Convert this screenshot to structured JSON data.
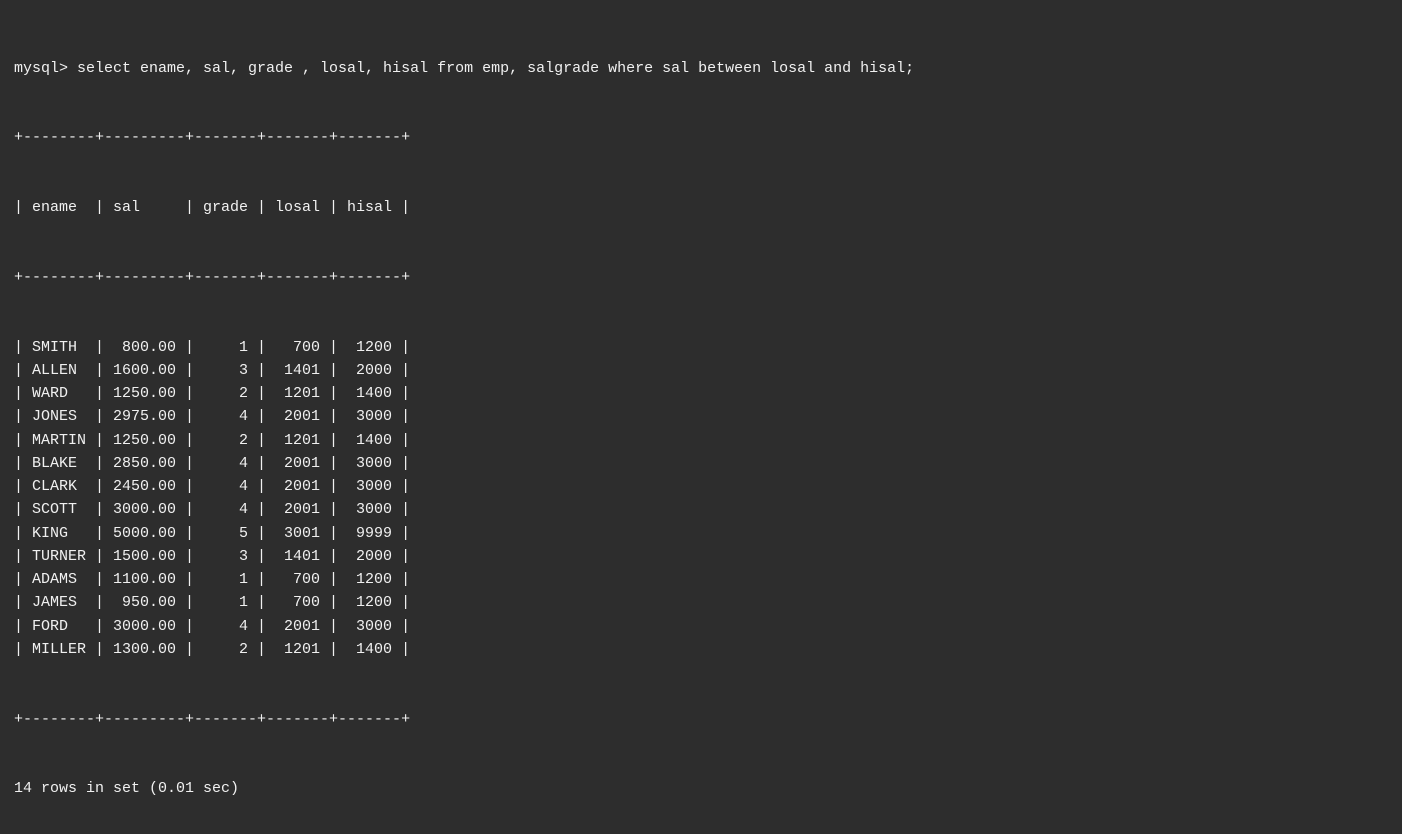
{
  "terminal": {
    "prompt": "mysql> select ename, sal, grade , losal, hisal from emp, salgrade where sal between losal and hisal;",
    "separator_top": "+--------+---------+-------+-------+-------+",
    "header": "| ename  | sal     | grade | losal | hisal |",
    "separator_mid": "+--------+---------+-------+-------+-------+",
    "rows": [
      "| SMITH  |  800.00 |     1 |   700 |  1200 |",
      "| ALLEN  | 1600.00 |     3 |  1401 |  2000 |",
      "| WARD   | 1250.00 |     2 |  1201 |  1400 |",
      "| JONES  | 2975.00 |     4 |  2001 |  3000 |",
      "| MARTIN | 1250.00 |     2 |  1201 |  1400 |",
      "| BLAKE  | 2850.00 |     4 |  2001 |  3000 |",
      "| CLARK  | 2450.00 |     4 |  2001 |  3000 |",
      "| SCOTT  | 3000.00 |     4 |  2001 |  3000 |",
      "| KING   | 5000.00 |     5 |  3001 |  9999 |",
      "| TURNER | 1500.00 |     3 |  1401 |  2000 |",
      "| ADAMS  | 1100.00 |     1 |   700 |  1200 |",
      "| JAMES  |  950.00 |     1 |   700 |  1200 |",
      "| FORD   | 3000.00 |     4 |  2001 |  3000 |",
      "| MILLER | 1300.00 |     2 |  1201 |  1400 |"
    ],
    "separator_bottom": "+--------+---------+-------+-------+-------+",
    "footer": "14 rows in set (0.01 sec)"
  }
}
